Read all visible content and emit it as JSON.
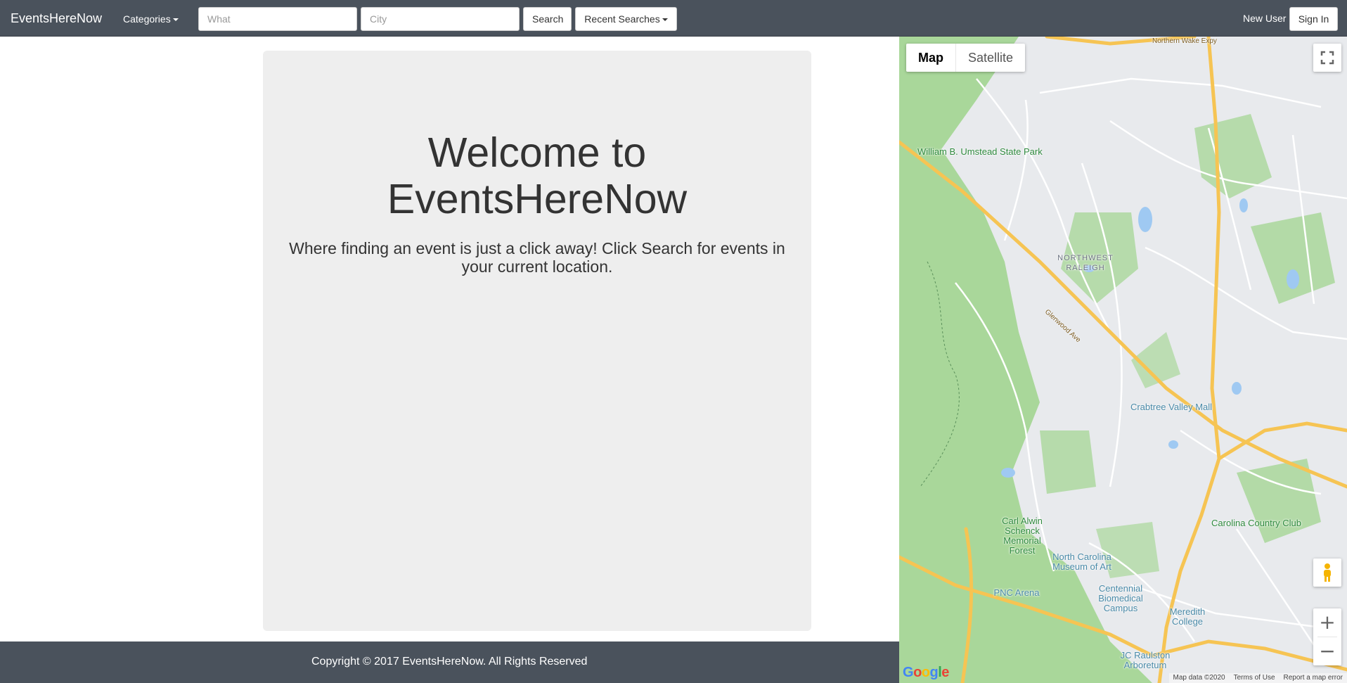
{
  "navbar": {
    "brand": "EventsHereNow",
    "categories_label": "Categories",
    "what_placeholder": "What",
    "city_placeholder": "City",
    "search_label": "Search",
    "recent_label": "Recent Searches",
    "new_user_label": "New User",
    "sign_in_label": "Sign In"
  },
  "main": {
    "title": "Welcome to EventsHereNow",
    "subtitle": "Where finding an event is just a click away! Click Search for events in your current location."
  },
  "footer": {
    "copyright": "Copyright © 2017 EventsHereNow. All Rights Reserved"
  },
  "map": {
    "type_map": "Map",
    "type_satellite": "Satellite",
    "zoom_in": "+",
    "zoom_out": "−",
    "logo": "Google",
    "attribution": "Map data ©2020",
    "terms": "Terms of Use",
    "report": "Report a map error",
    "places": {
      "umstead": "William B. Umstead State Park",
      "nw_raleigh": "NORTHWEST RALEIGH",
      "crabtree": "Crabtree Valley Mall",
      "carl_alwin": "Carl Alwin Schenck Memorial Forest",
      "nc_museum": "North Carolina Museum of Art",
      "carolina_cc": "Carolina Country Club",
      "pnc": "PNC Arena",
      "centennial": "Centennial Biomedical Campus",
      "meredith": "Meredith College",
      "jc_raulston": "JC Raulston Arboretum",
      "glenwood": "Glenwood Ave",
      "wake_expy": "Northern Wake Expy"
    },
    "colors": {
      "park": "#a9d79a",
      "urban": "#e8eaed",
      "highway": "#f6c453",
      "road": "#ffffff",
      "water": "#9fc9f2"
    }
  }
}
